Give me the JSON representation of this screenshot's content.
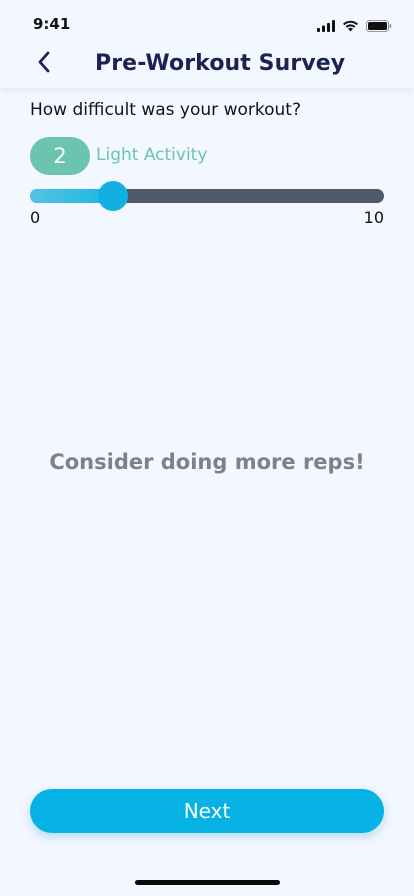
{
  "status_bar": {
    "time": "9:41",
    "icons": [
      "cellular-signal-icon",
      "wifi-icon",
      "battery-icon"
    ]
  },
  "header": {
    "title": "Pre-Workout Survey",
    "back_icon": "chevron-left-icon"
  },
  "survey": {
    "question": "How difficult was your workout?",
    "value": "2",
    "value_label": "Light Activity",
    "slider": {
      "min_label": "0",
      "max_label": "10",
      "min": 0,
      "max": 10,
      "current": 2.1
    }
  },
  "message": "Consider doing more reps!",
  "next_button": {
    "label": "Next"
  },
  "colors": {
    "background": "#f3f7ff",
    "title": "#1b2450",
    "badge": "#6bc4ae",
    "accent": "#06b2e4",
    "track": "#4f5a68",
    "message": "#7d818a"
  }
}
